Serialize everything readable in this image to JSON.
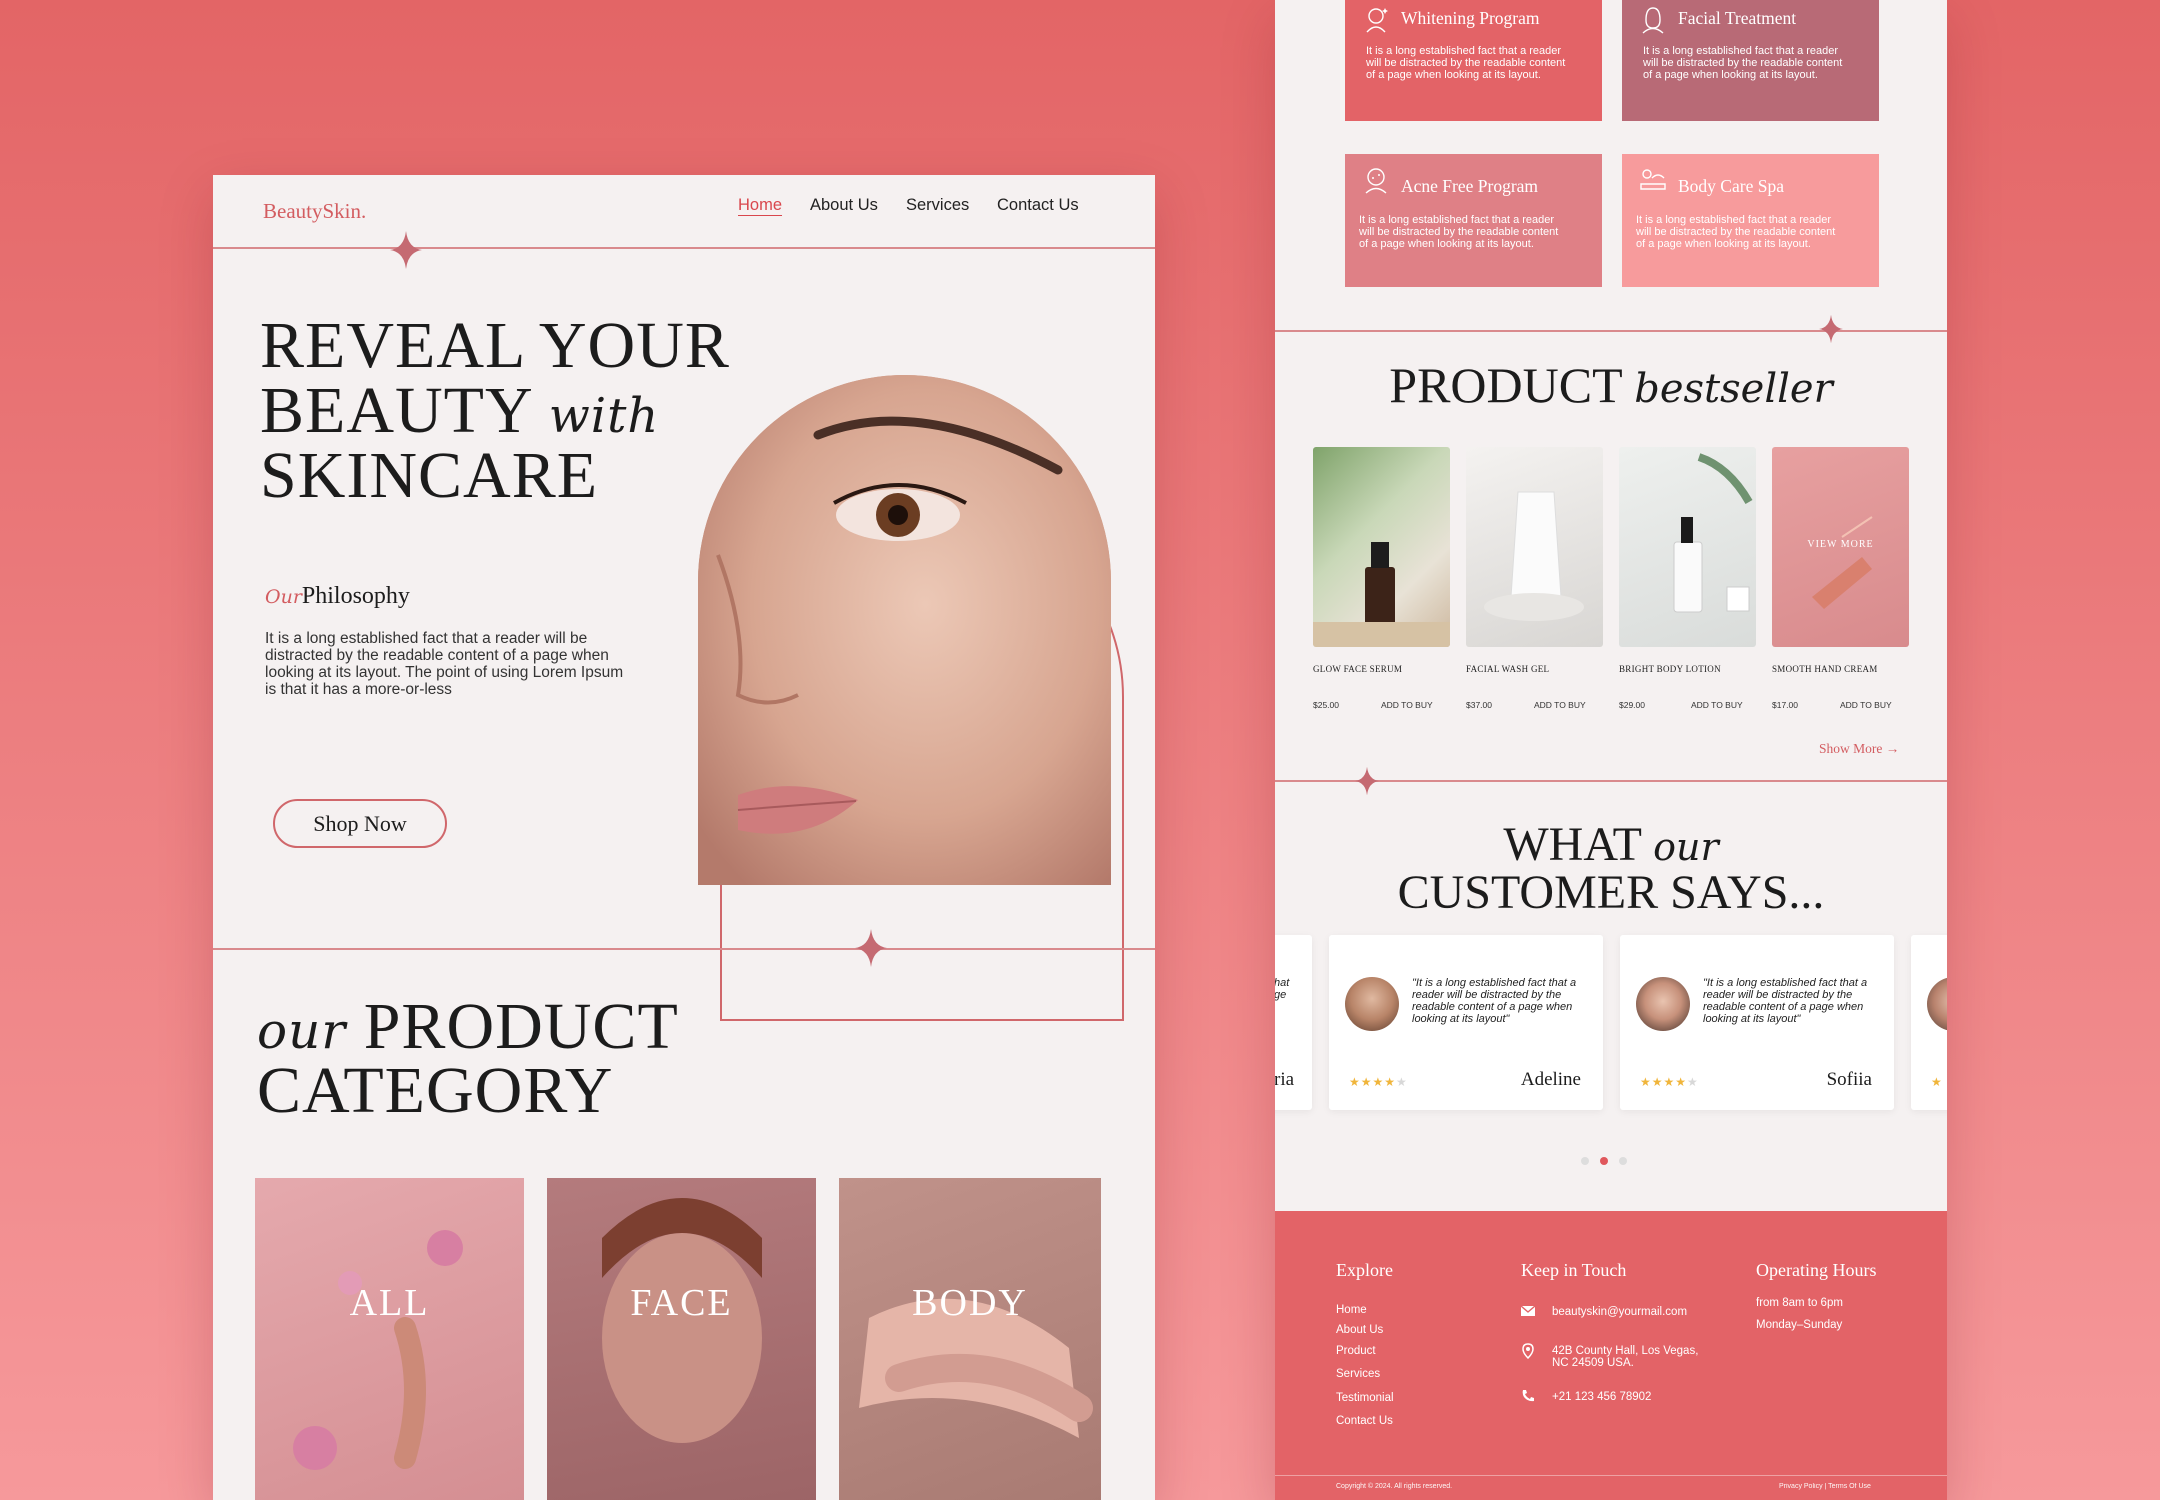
{
  "landing": {
    "logo": "BeautySkin.",
    "nav": [
      "Home",
      "About Us",
      "Services",
      "Contact Us"
    ],
    "hero": {
      "line1": "REVEAL YOUR",
      "line2": "BEAUTY",
      "line2_italic": "with",
      "line3": "SKINCARE"
    },
    "philosophy": {
      "our": "Our",
      "title": "Philosophy",
      "text": "It is a long established fact that a reader will be distracted by the readable content of a page when looking at its layout. The point of using Lorem Ipsum is that it has a more-or-less"
    },
    "shop_button": "Shop Now",
    "category": {
      "our": "our",
      "title1": "PRODUCT",
      "title2": "CATEGORY",
      "cards": [
        "ALL",
        "FACE",
        "BODY"
      ]
    }
  },
  "detail": {
    "services": [
      {
        "title": "Whitening Program",
        "text": "It is a long established fact that a reader will be distracted by the readable content of a page when looking at its layout.",
        "color": "#e36367"
      },
      {
        "title": "Facial Treatment",
        "text": "It is a long established fact that a reader will be distracted by the readable content of a page when looking at its layout.",
        "color": "#b86a76"
      },
      {
        "title": "Acne Free Program",
        "text": "It is a long established fact that a reader will be distracted by the readable content of a page when looking at its layout.",
        "color": "#df8086"
      },
      {
        "title": "Body Care Spa",
        "text": "It is a long established fact that a reader will be distracted by the readable content of a page when looking at its layout.",
        "color": "#f79b9c"
      }
    ],
    "bestseller": {
      "title": "PRODUCT",
      "italic": "bestseller"
    },
    "products": [
      {
        "name": "GLOW FACE SERUM",
        "price": "$25.00",
        "buy": "ADD TO BUY"
      },
      {
        "name": "FACIAL WASH GEL",
        "price": "$37.00",
        "buy": "ADD TO BUY"
      },
      {
        "name": "BRIGHT BODY LOTION",
        "price": "$29.00",
        "buy": "ADD TO BUY"
      },
      {
        "name": "SMOOTH HAND CREAM",
        "price": "$17.00",
        "buy": "ADD TO BUY",
        "overlay": "VIEW MORE"
      }
    ],
    "show_more": "Show More",
    "testimonial_title": {
      "line1": "WHAT",
      "italic": "our",
      "line2": "CUSTOMER SAYS..."
    },
    "testimonials": [
      {
        "quote": "\"It is a long established fact that a reader will be distracted by the readable content of a page when looking at its layout\"",
        "name": "Adeline",
        "stars": "★★★★",
        "star_off": "★",
        "rating": 4
      },
      {
        "quote": "\"It is a long established fact that a reader will be distracted by the readable content of a page when looking at its layout\"",
        "name": "Sofiia",
        "stars": "★★★★",
        "star_off": "★",
        "rating": 4
      }
    ],
    "testimonial_partial_left": {
      "quote_fragments": [
        "hat",
        "ge"
      ],
      "name_fragment": "ria"
    },
    "footer": {
      "explore_title": "Explore",
      "explore": [
        "Home",
        "About Us",
        "Product",
        "Services",
        "Testimonial",
        "Contact Us"
      ],
      "touch_title": "Keep in Touch",
      "email": "beautyskin@yourmail.com",
      "address": "42B County Hall, Los Vegas, NC 24509 USA.",
      "phone": "+21 123 456 78902",
      "hours_title": "Operating Hours",
      "hours": "from 8am to 6pm",
      "days": "Monday–Sunday",
      "copyright": "Copyright © 2024. All rights reserved.",
      "legal": "Privacy Policy | Terms Of Use"
    }
  }
}
